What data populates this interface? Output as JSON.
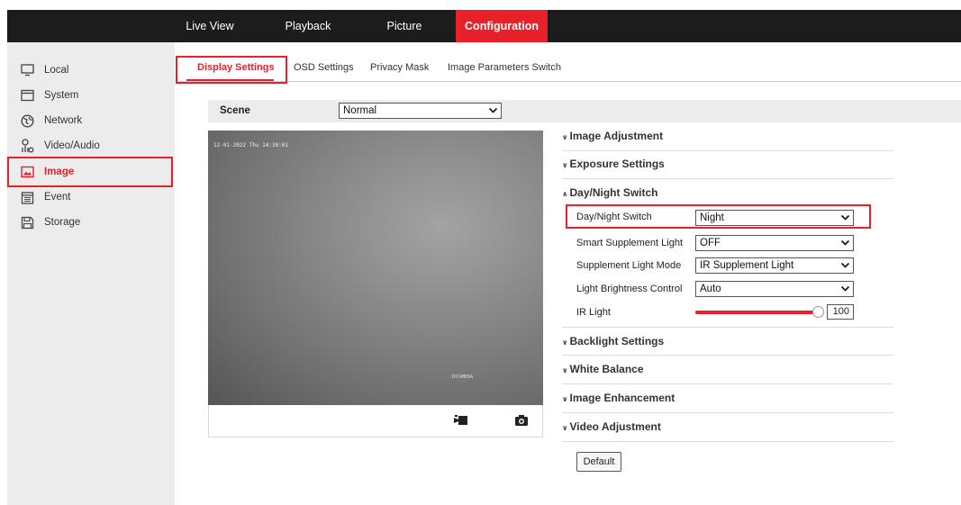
{
  "top_nav": {
    "items": [
      {
        "label": "Live View"
      },
      {
        "label": "Playback"
      },
      {
        "label": "Picture"
      },
      {
        "label": "Configuration"
      }
    ]
  },
  "sidebar": {
    "items": [
      {
        "label": "Local",
        "icon": "monitor-icon"
      },
      {
        "label": "System",
        "icon": "system-window-icon"
      },
      {
        "label": "Network",
        "icon": "globe-icon"
      },
      {
        "label": "Video/Audio",
        "icon": "video-audio-icon"
      },
      {
        "label": "Image",
        "icon": "image-icon"
      },
      {
        "label": "Event",
        "icon": "calendar-icon"
      },
      {
        "label": "Storage",
        "icon": "floppy-disk-icon"
      }
    ]
  },
  "sub_tabs": [
    {
      "label": "Display Settings"
    },
    {
      "label": "OSD Settings"
    },
    {
      "label": "Privacy Mask"
    },
    {
      "label": "Image Parameters Switch"
    }
  ],
  "scene": {
    "label": "Scene",
    "value": "Normal"
  },
  "video": {
    "osd_text": "12-01-2022 Thu 14:30:01",
    "camera_name": "IPCAMERA",
    "record_icon": "record-camera-icon",
    "snapshot_icon": "snapshot-camera-icon"
  },
  "sections": {
    "image_adjustment": "Image Adjustment",
    "exposure_settings": "Exposure Settings",
    "day_night_switch": "Day/Night Switch",
    "backlight_settings": "Backlight Settings",
    "white_balance": "White Balance",
    "image_enhancement": "Image Enhancement",
    "video_adjustment": "Video Adjustment"
  },
  "day_night": {
    "switch": {
      "label": "Day/Night Switch",
      "value": "Night"
    },
    "smart_supplement": {
      "label": "Smart Supplement Light",
      "value": "OFF"
    },
    "supplement_mode": {
      "label": "Supplement Light Mode",
      "value": "IR Supplement Light"
    },
    "brightness_control": {
      "label": "Light Brightness Control",
      "value": "Auto"
    },
    "ir_light": {
      "label": "IR Light",
      "value": "100",
      "level_percent": 100
    }
  },
  "buttons": {
    "default": "Default"
  },
  "colors": {
    "accent": "#e8202a",
    "nav_bg": "#1c1c1c",
    "sidebar_bg": "#ececec"
  }
}
